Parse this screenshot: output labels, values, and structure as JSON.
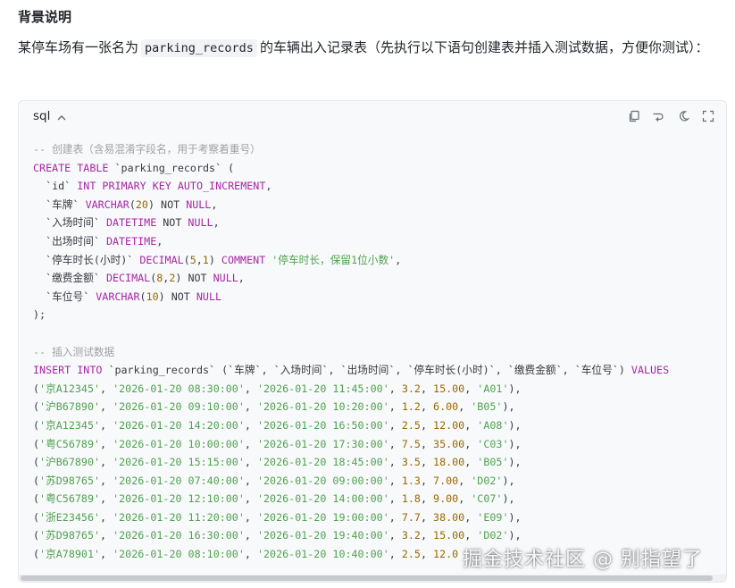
{
  "article": {
    "heading": "背景说明",
    "intro_before": "某停车场有一张名为",
    "table_name": "parking_records",
    "intro_after": "的车辆出入记录表（先执行以下语句创建表并插入测试数据，方便你测试）："
  },
  "code_block": {
    "language": "sql",
    "icons": {
      "collapse": "chevron-up-icon",
      "copy": "copy-icon",
      "wrap": "wrap-icon",
      "theme": "moon-icon",
      "expand": "fullscreen-icon"
    },
    "colors": {
      "comment": "#a0a1a7",
      "keyword": "#a626a4",
      "string": "#50a14f",
      "number": "#986801",
      "plain": "#383a42"
    },
    "lines": [
      [
        [
          "c",
          "-- 创建表（含易混淆字段名，用于考察着重号）"
        ]
      ],
      [
        [
          "k",
          "CREATE TABLE"
        ],
        [
          "p",
          " `parking_records` ("
        ]
      ],
      [
        [
          "p",
          "  `id` "
        ],
        [
          "k",
          "INT PRIMARY KEY AUTO_INCREMENT"
        ],
        [
          "p",
          ","
        ]
      ],
      [
        [
          "p",
          "  `车牌` "
        ],
        [
          "k",
          "VARCHAR"
        ],
        [
          "p",
          "("
        ],
        [
          "n",
          "20"
        ],
        [
          "p",
          ") NOT "
        ],
        [
          "k",
          "NULL"
        ],
        [
          "p",
          ","
        ]
      ],
      [
        [
          "p",
          "  `入场时间` "
        ],
        [
          "k",
          "DATETIME"
        ],
        [
          "p",
          " NOT "
        ],
        [
          "k",
          "NULL"
        ],
        [
          "p",
          ","
        ]
      ],
      [
        [
          "p",
          "  `出场时间` "
        ],
        [
          "k",
          "DATETIME"
        ],
        [
          "p",
          ","
        ]
      ],
      [
        [
          "p",
          "  `停车时长(小时)` "
        ],
        [
          "k",
          "DECIMAL"
        ],
        [
          "p",
          "("
        ],
        [
          "n",
          "5"
        ],
        [
          "p",
          ","
        ],
        [
          "n",
          "1"
        ],
        [
          "p",
          ") "
        ],
        [
          "k",
          "COMMENT"
        ],
        [
          "p",
          " "
        ],
        [
          "s",
          "'停车时长，保留1位小数'"
        ],
        [
          "p",
          ","
        ]
      ],
      [
        [
          "p",
          "  `缴费金额` "
        ],
        [
          "k",
          "DECIMAL"
        ],
        [
          "p",
          "("
        ],
        [
          "n",
          "8"
        ],
        [
          "p",
          ","
        ],
        [
          "n",
          "2"
        ],
        [
          "p",
          ") NOT "
        ],
        [
          "k",
          "NULL"
        ],
        [
          "p",
          ","
        ]
      ],
      [
        [
          "p",
          "  `车位号` "
        ],
        [
          "k",
          "VARCHAR"
        ],
        [
          "p",
          "("
        ],
        [
          "n",
          "10"
        ],
        [
          "p",
          ") NOT "
        ],
        [
          "k",
          "NULL"
        ]
      ],
      [
        [
          "p",
          ");"
        ]
      ],
      [
        [
          "p",
          ""
        ]
      ],
      [
        [
          "c",
          "-- 插入测试数据"
        ]
      ],
      [
        [
          "k",
          "INSERT INTO"
        ],
        [
          "p",
          " `parking_records` (`车牌`, `入场时间`, `出场时间`, `停车时长(小时)`, `缴费金额`, `车位号`) "
        ],
        [
          "k",
          "VALUES"
        ]
      ],
      [
        [
          "p",
          "("
        ],
        [
          "s",
          "'京A12345'"
        ],
        [
          "p",
          ", "
        ],
        [
          "s",
          "'2026-01-20 08:30:00'"
        ],
        [
          "p",
          ", "
        ],
        [
          "s",
          "'2026-01-20 11:45:00'"
        ],
        [
          "p",
          ", "
        ],
        [
          "n",
          "3.2"
        ],
        [
          "p",
          ", "
        ],
        [
          "n",
          "15.00"
        ],
        [
          "p",
          ", "
        ],
        [
          "s",
          "'A01'"
        ],
        [
          "p",
          "),"
        ]
      ],
      [
        [
          "p",
          "("
        ],
        [
          "s",
          "'沪B67890'"
        ],
        [
          "p",
          ", "
        ],
        [
          "s",
          "'2026-01-20 09:10:00'"
        ],
        [
          "p",
          ", "
        ],
        [
          "s",
          "'2026-01-20 10:20:00'"
        ],
        [
          "p",
          ", "
        ],
        [
          "n",
          "1.2"
        ],
        [
          "p",
          ", "
        ],
        [
          "n",
          "6.00"
        ],
        [
          "p",
          ", "
        ],
        [
          "s",
          "'B05'"
        ],
        [
          "p",
          "),"
        ]
      ],
      [
        [
          "p",
          "("
        ],
        [
          "s",
          "'京A12345'"
        ],
        [
          "p",
          ", "
        ],
        [
          "s",
          "'2026-01-20 14:20:00'"
        ],
        [
          "p",
          ", "
        ],
        [
          "s",
          "'2026-01-20 16:50:00'"
        ],
        [
          "p",
          ", "
        ],
        [
          "n",
          "2.5"
        ],
        [
          "p",
          ", "
        ],
        [
          "n",
          "12.00"
        ],
        [
          "p",
          ", "
        ],
        [
          "s",
          "'A08'"
        ],
        [
          "p",
          "),"
        ]
      ],
      [
        [
          "p",
          "("
        ],
        [
          "s",
          "'粤C56789'"
        ],
        [
          "p",
          ", "
        ],
        [
          "s",
          "'2026-01-20 10:00:00'"
        ],
        [
          "p",
          ", "
        ],
        [
          "s",
          "'2026-01-20 17:30:00'"
        ],
        [
          "p",
          ", "
        ],
        [
          "n",
          "7.5"
        ],
        [
          "p",
          ", "
        ],
        [
          "n",
          "35.00"
        ],
        [
          "p",
          ", "
        ],
        [
          "s",
          "'C03'"
        ],
        [
          "p",
          "),"
        ]
      ],
      [
        [
          "p",
          "("
        ],
        [
          "s",
          "'沪B67890'"
        ],
        [
          "p",
          ", "
        ],
        [
          "s",
          "'2026-01-20 15:15:00'"
        ],
        [
          "p",
          ", "
        ],
        [
          "s",
          "'2026-01-20 18:45:00'"
        ],
        [
          "p",
          ", "
        ],
        [
          "n",
          "3.5"
        ],
        [
          "p",
          ", "
        ],
        [
          "n",
          "18.00"
        ],
        [
          "p",
          ", "
        ],
        [
          "s",
          "'B05'"
        ],
        [
          "p",
          "),"
        ]
      ],
      [
        [
          "p",
          "("
        ],
        [
          "s",
          "'苏D98765'"
        ],
        [
          "p",
          ", "
        ],
        [
          "s",
          "'2026-01-20 07:40:00'"
        ],
        [
          "p",
          ", "
        ],
        [
          "s",
          "'2026-01-20 09:00:00'"
        ],
        [
          "p",
          ", "
        ],
        [
          "n",
          "1.3"
        ],
        [
          "p",
          ", "
        ],
        [
          "n",
          "7.00"
        ],
        [
          "p",
          ", "
        ],
        [
          "s",
          "'D02'"
        ],
        [
          "p",
          "),"
        ]
      ],
      [
        [
          "p",
          "("
        ],
        [
          "s",
          "'粤C56789'"
        ],
        [
          "p",
          ", "
        ],
        [
          "s",
          "'2026-01-20 12:10:00'"
        ],
        [
          "p",
          ", "
        ],
        [
          "s",
          "'2026-01-20 14:00:00'"
        ],
        [
          "p",
          ", "
        ],
        [
          "n",
          "1.8"
        ],
        [
          "p",
          ", "
        ],
        [
          "n",
          "9.00"
        ],
        [
          "p",
          ", "
        ],
        [
          "s",
          "'C07'"
        ],
        [
          "p",
          "),"
        ]
      ],
      [
        [
          "p",
          "("
        ],
        [
          "s",
          "'浙E23456'"
        ],
        [
          "p",
          ", "
        ],
        [
          "s",
          "'2026-01-20 11:20:00'"
        ],
        [
          "p",
          ", "
        ],
        [
          "s",
          "'2026-01-20 19:00:00'"
        ],
        [
          "p",
          ", "
        ],
        [
          "n",
          "7.7"
        ],
        [
          "p",
          ", "
        ],
        [
          "n",
          "38.00"
        ],
        [
          "p",
          ", "
        ],
        [
          "s",
          "'E09'"
        ],
        [
          "p",
          "),"
        ]
      ],
      [
        [
          "p",
          "("
        ],
        [
          "s",
          "'苏D98765'"
        ],
        [
          "p",
          ", "
        ],
        [
          "s",
          "'2026-01-20 16:30:00'"
        ],
        [
          "p",
          ", "
        ],
        [
          "s",
          "'2026-01-20 19:40:00'"
        ],
        [
          "p",
          ", "
        ],
        [
          "n",
          "3.2"
        ],
        [
          "p",
          ", "
        ],
        [
          "n",
          "15.00"
        ],
        [
          "p",
          ", "
        ],
        [
          "s",
          "'D02'"
        ],
        [
          "p",
          "),"
        ]
      ],
      [
        [
          "p",
          "("
        ],
        [
          "s",
          "'京A78901'"
        ],
        [
          "p",
          ", "
        ],
        [
          "s",
          "'2026-01-20 08:10:00'"
        ],
        [
          "p",
          ", "
        ],
        [
          "s",
          "'2026-01-20 10:40:00'"
        ],
        [
          "p",
          ", "
        ],
        [
          "n",
          "2.5"
        ],
        [
          "p",
          ", "
        ],
        [
          "n",
          "12.0"
        ]
      ]
    ]
  },
  "watermark": {
    "text": "掘金技术社区 @ 别指望了"
  }
}
